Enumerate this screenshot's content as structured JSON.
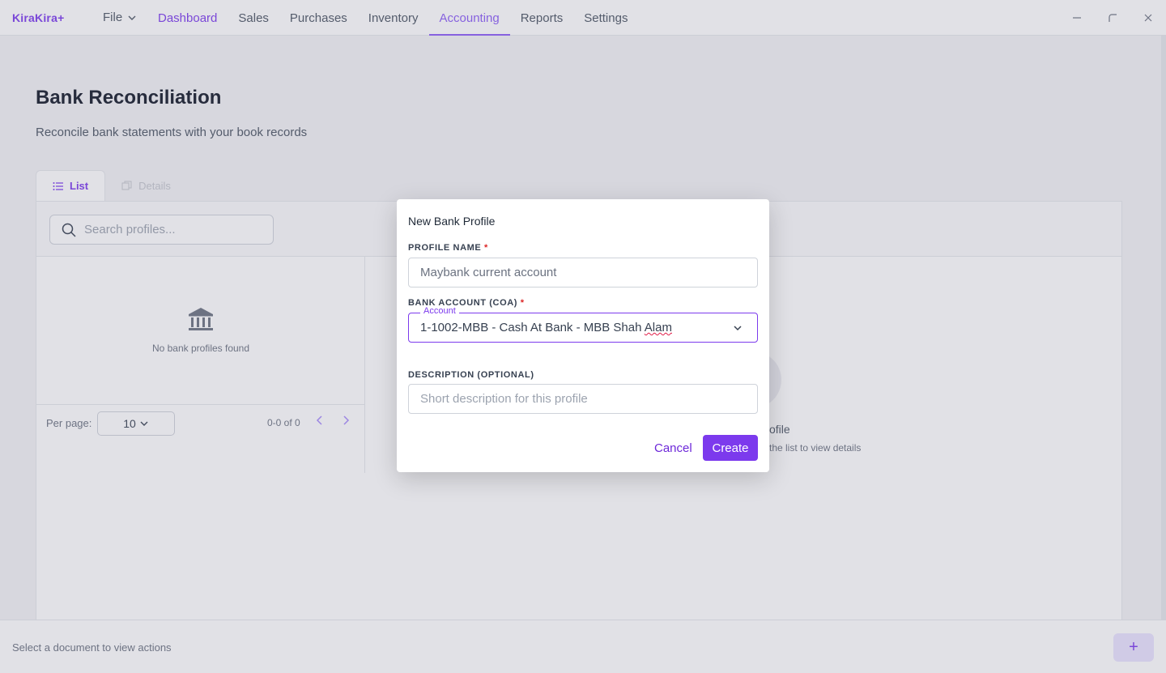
{
  "app": {
    "logo": "KiraKira+"
  },
  "menu": {
    "file_label": "File"
  },
  "nav": {
    "items": [
      {
        "label": "Dashboard"
      },
      {
        "label": "Sales"
      },
      {
        "label": "Purchases"
      },
      {
        "label": "Inventory"
      },
      {
        "label": "Accounting"
      },
      {
        "label": "Reports"
      },
      {
        "label": "Settings"
      }
    ],
    "active": "Accounting"
  },
  "page": {
    "title": "Bank Reconciliation",
    "subtitle": "Reconcile bank statements with your book records"
  },
  "tabs": [
    {
      "label": "List"
    },
    {
      "label": "Details"
    }
  ],
  "search": {
    "placeholder": "Search profiles..."
  },
  "list": {
    "empty_text": "No bank profiles found",
    "per_page_label": "Per page:",
    "per_page_value": "10",
    "range": "0-0 of 0"
  },
  "detail_hint": {
    "title": "ofile",
    "subtitle": "the list to view details"
  },
  "bottom": {
    "hint": "Select a document to view actions",
    "fab_label": "+"
  },
  "dialog": {
    "title": "New Bank Profile",
    "profile_name": {
      "label": "PROFILE NAME",
      "required": "*",
      "placeholder": "Maybank current account",
      "value": ""
    },
    "bank_account": {
      "label": "BANK ACCOUNT (COA)",
      "required": "*",
      "legend": "Account",
      "value_main": "1-1002-MBB - Cash At Bank - MBB Shah ",
      "value_squiggle": "Alam"
    },
    "description": {
      "label": "DESCRIPTION (OPTIONAL)",
      "placeholder": "Short description for this profile",
      "value": ""
    },
    "cancel_label": "Cancel",
    "create_label": "Create"
  },
  "colors": {
    "accent": "#7c3aed",
    "accent_light": "#8b5cf6"
  }
}
